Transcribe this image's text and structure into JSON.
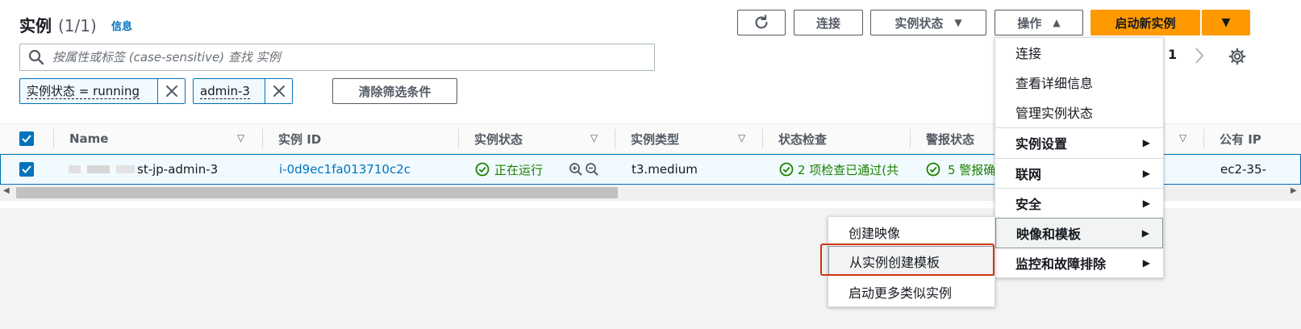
{
  "header": {
    "title": "实例",
    "count": "(1/1)",
    "info": "信息"
  },
  "toolbar": {
    "refresh_icon": "refresh-icon",
    "connect": "连接",
    "instance_state": "实例状态",
    "actions": "操作",
    "launch": "启动新实例"
  },
  "search": {
    "placeholder": "按属性或标签 (case-sensitive) 查找 实例"
  },
  "filters": {
    "chips": [
      "实例状态 = running",
      "admin-3"
    ],
    "clear": "清除筛选条件"
  },
  "pagination": {
    "page": "1"
  },
  "table": {
    "columns": [
      "Name",
      "实例 ID",
      "实例状态",
      "实例类型",
      "状态检查",
      "警报状态",
      "公有 IP"
    ],
    "row": {
      "name": "st-jp-admin-3",
      "instance_id": "i-0d9ec1fa013710c2c",
      "state": "正在运行",
      "type": "t3.medium",
      "status_check": "2 项检查已通过(共",
      "alarm": "5 警报确",
      "public_ip": "ec2-35-"
    }
  },
  "actions_menu": {
    "items": [
      "连接",
      "查看详细信息",
      "管理实例状态",
      "实例设置",
      "联网",
      "安全",
      "映像和模板",
      "监控和故障排除"
    ]
  },
  "image_submenu": {
    "items": [
      "创建映像",
      "从实例创建模板",
      "启动更多类似实例"
    ]
  },
  "colors": {
    "primary": "#ff9900",
    "link": "#0073bb",
    "success": "#1d8102",
    "highlight": "#d13212"
  }
}
